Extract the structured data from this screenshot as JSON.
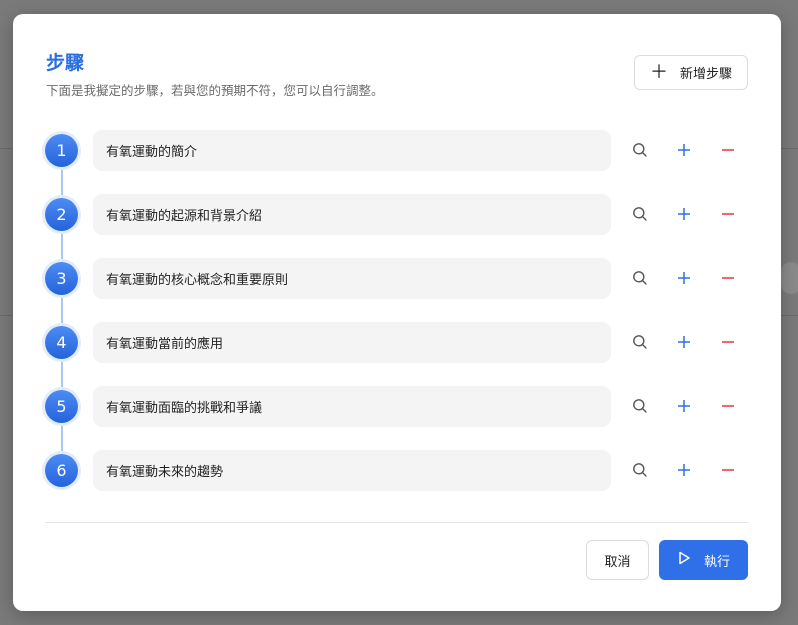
{
  "modal": {
    "title": "步驟",
    "subtitle": "下面是我擬定的步驟，若與您的預期不符，您可以自行調整。",
    "add_step_label": "新增步驟",
    "cancel_label": "取消",
    "run_label": "執行"
  },
  "steps": [
    {
      "number": "1",
      "text": "有氧運動的簡介"
    },
    {
      "number": "2",
      "text": "有氧運動的起源和背景介紹"
    },
    {
      "number": "3",
      "text": "有氧運動的核心概念和重要原則"
    },
    {
      "number": "4",
      "text": "有氧運動當前的應用"
    },
    {
      "number": "5",
      "text": "有氧運動面臨的挑戰和爭議"
    },
    {
      "number": "6",
      "text": "有氧運動未來的趨勢"
    }
  ],
  "icons": {
    "add": "plus-icon",
    "search": "search-icon",
    "insert": "plus-icon",
    "remove": "minus-icon",
    "run": "play-icon"
  },
  "colors": {
    "accent": "#2d6fe0",
    "danger": "#e03838",
    "step_bg": "#f4f4f4"
  }
}
